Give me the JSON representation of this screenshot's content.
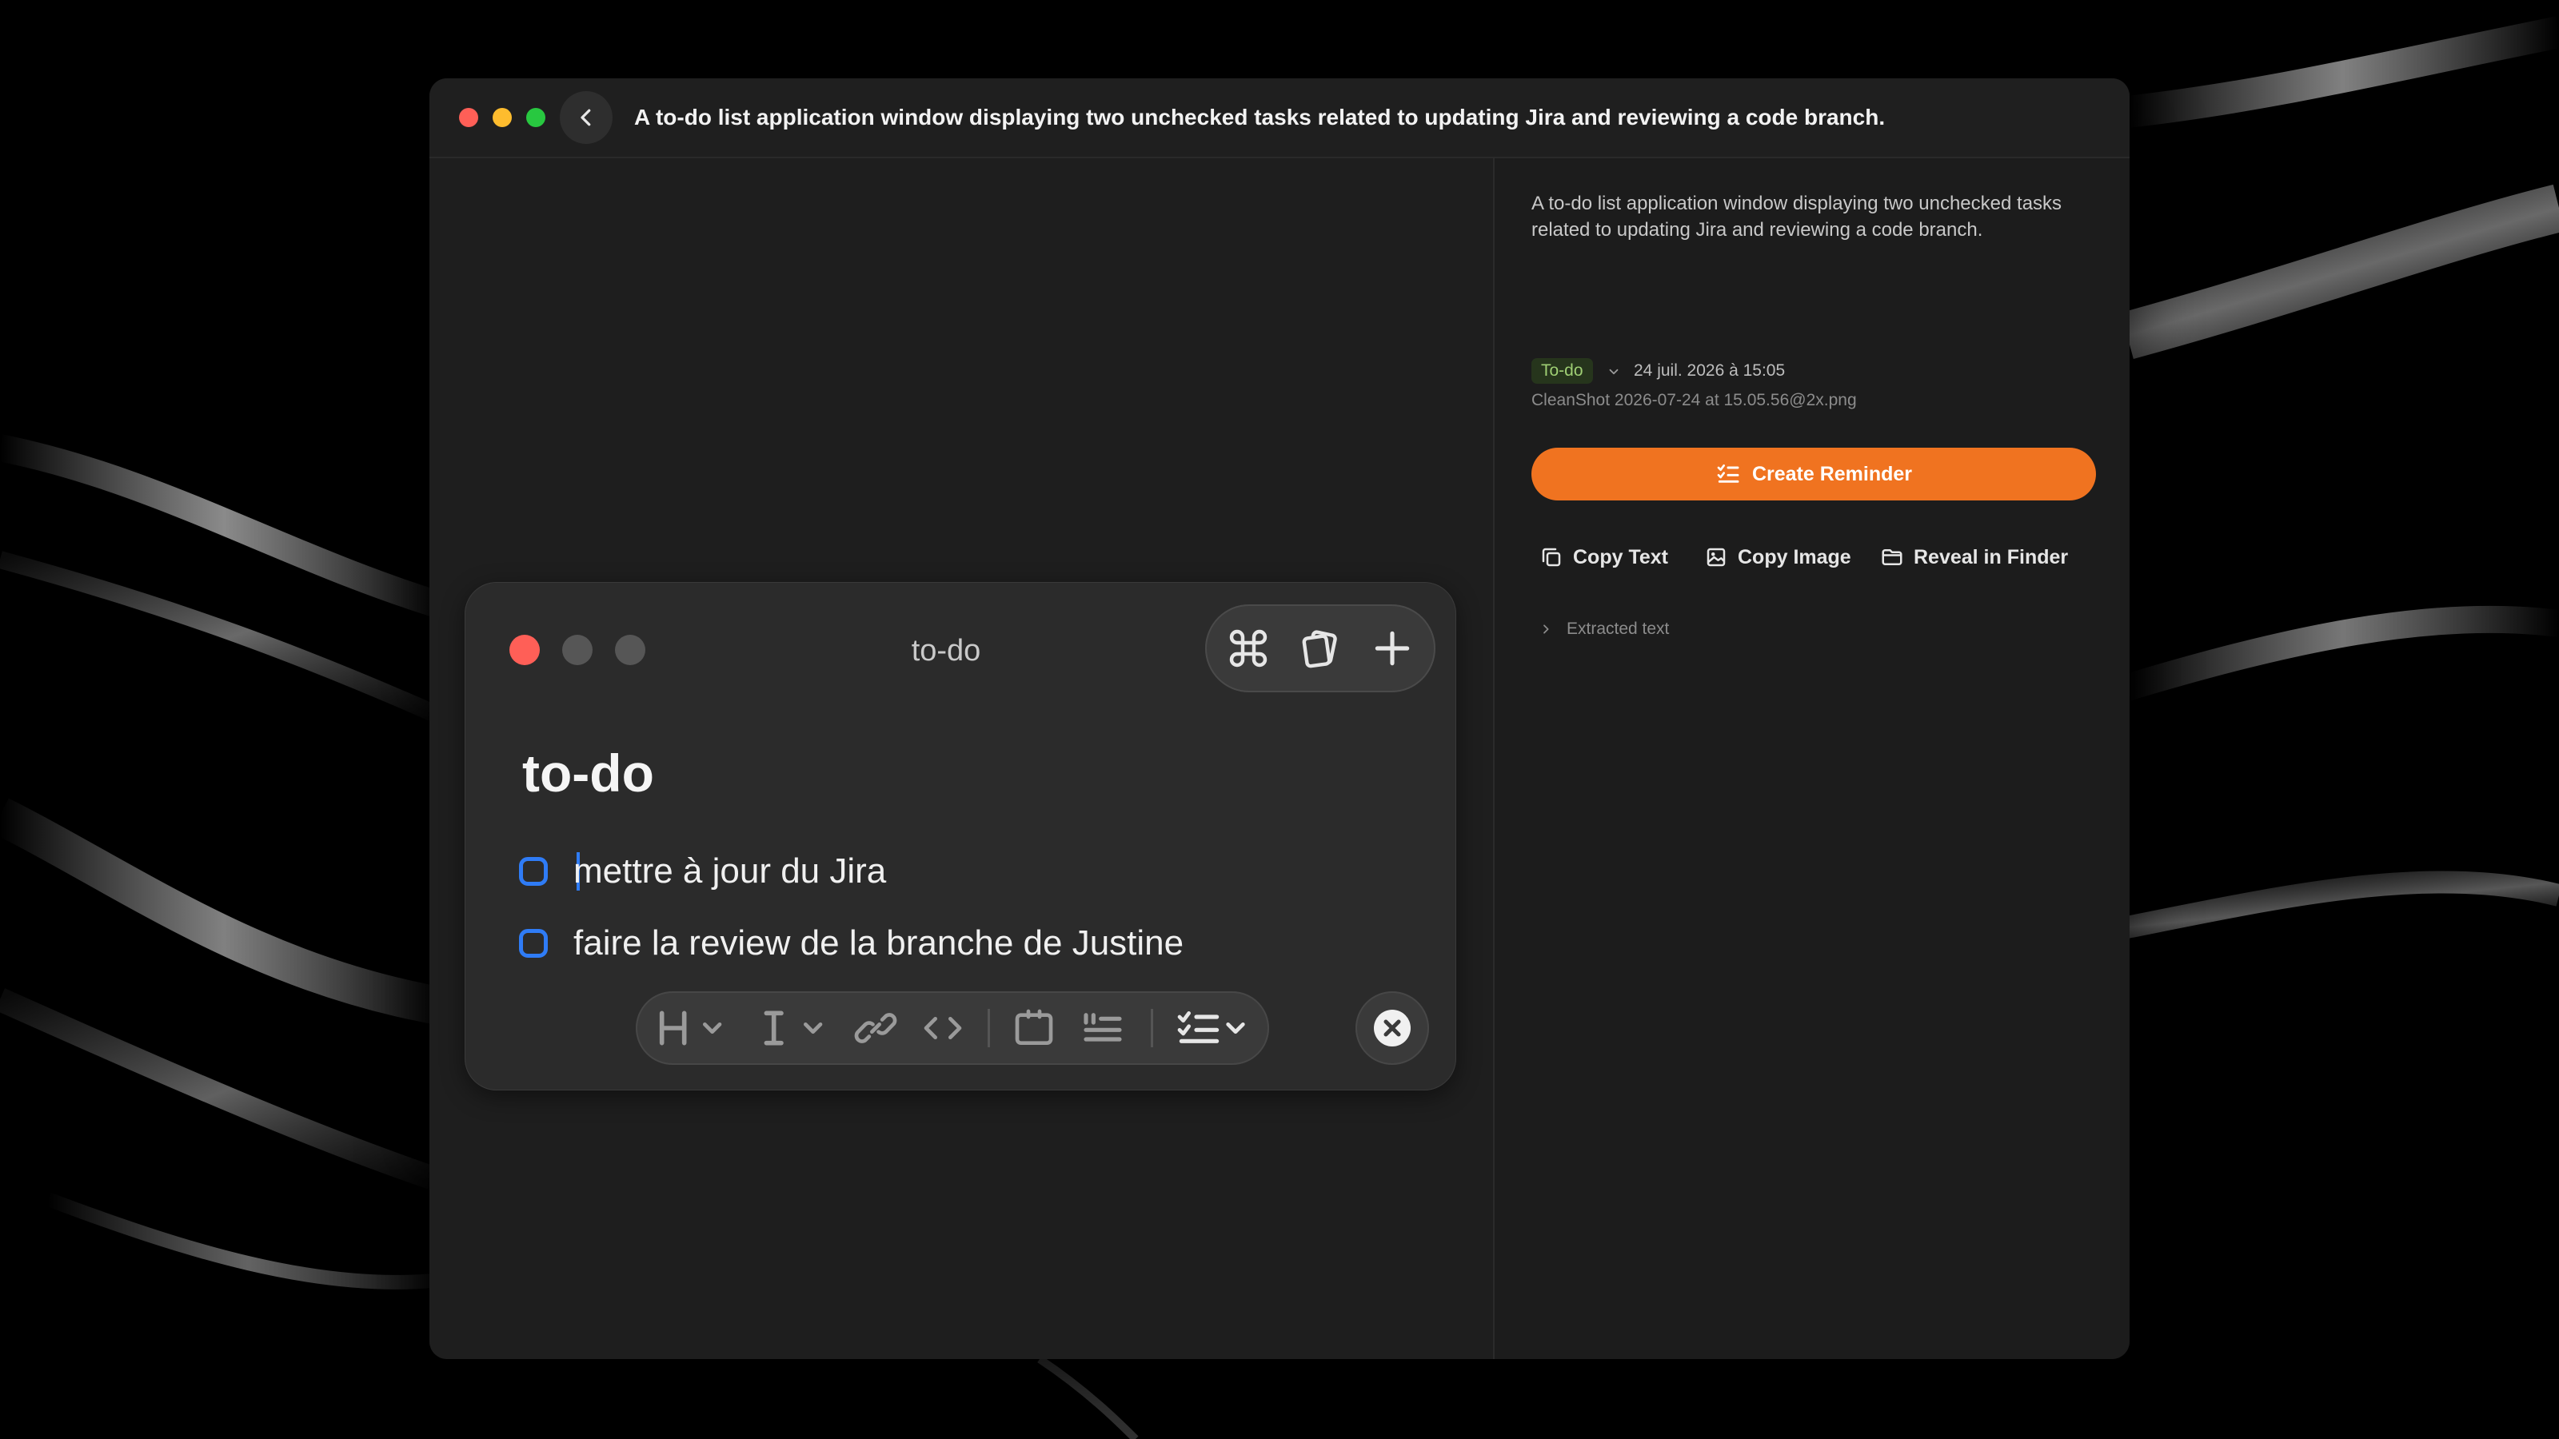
{
  "window": {
    "title": "A to-do list application window displaying two unchecked tasks related to updating Jira and reviewing a code branch."
  },
  "note": {
    "window_title": "to-do",
    "heading": "to-do",
    "tasks": [
      {
        "text": "mettre à jour du Jira",
        "checked": false
      },
      {
        "text": "faire la review de la branche de Justine",
        "checked": false
      }
    ],
    "format_tools": [
      "heading-icon",
      "text-style-icon",
      "link-icon",
      "code-icon",
      "code-block-icon",
      "quote-icon",
      "checklist-icon"
    ]
  },
  "sidebar": {
    "description": "A to-do list application window displaying two unchecked tasks related to updating Jira and reviewing a code branch.",
    "tag": "To-do",
    "date": "24 juil. 2026 à 15:05",
    "filename": "CleanShot 2026-07-24 at 15.05.56@2x.png",
    "create_reminder": "Create Reminder",
    "actions": {
      "copy_text": "Copy Text",
      "copy_image": "Copy Image",
      "reveal_in_finder": "Reveal in Finder"
    },
    "extracted_text": "Extracted text"
  },
  "colors": {
    "accent": "#f07320",
    "checkbox": "#2f7cf6",
    "tag_bg": "#26351c",
    "tag_text": "#9fcf74"
  }
}
